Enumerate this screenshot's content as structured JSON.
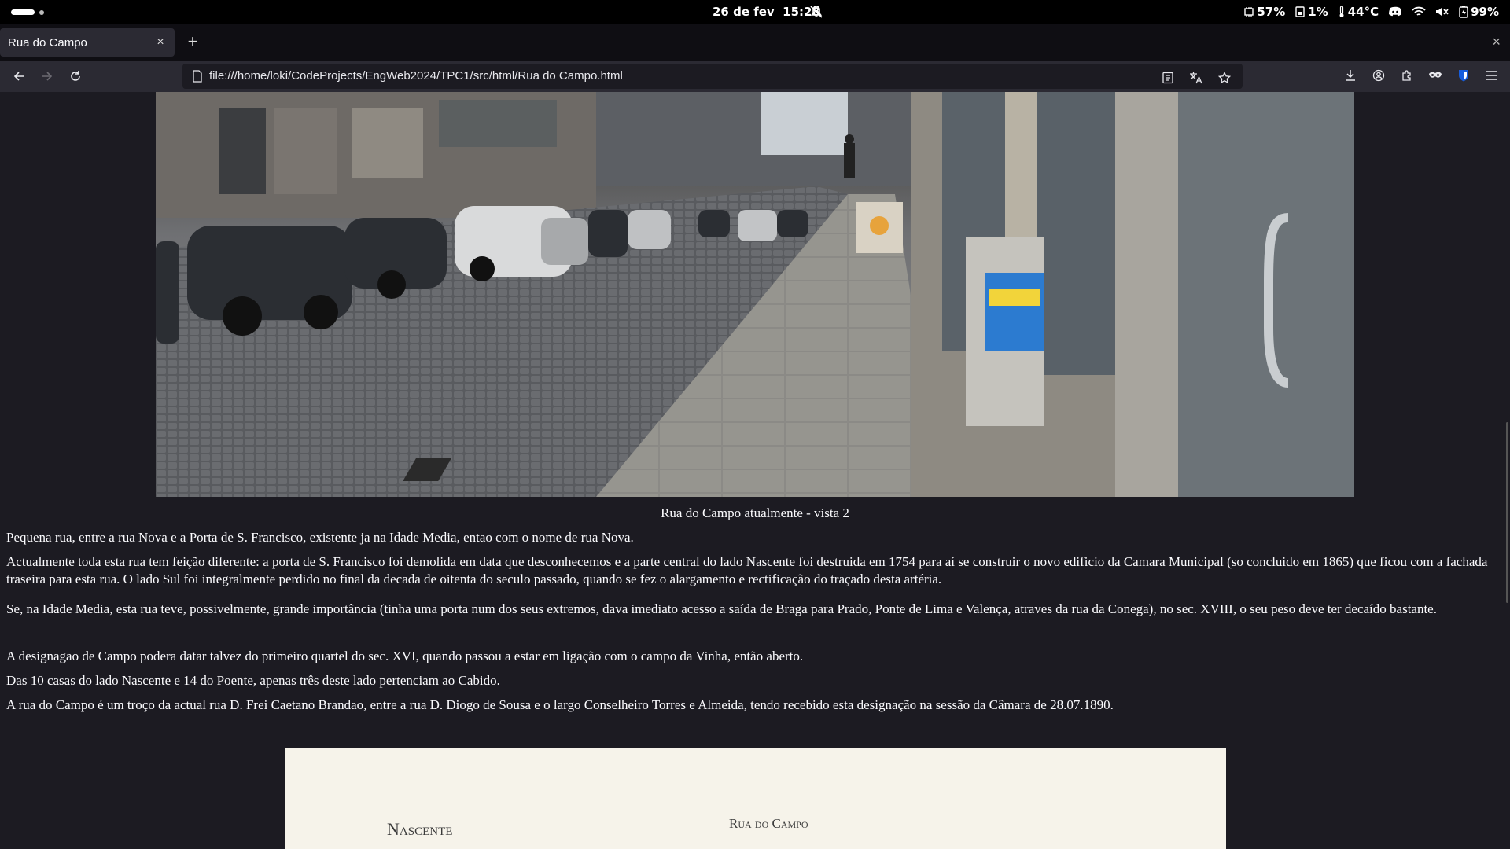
{
  "system_bar": {
    "date": "26 de fev",
    "time": "15:28",
    "cpu": "57%",
    "disk": "1%",
    "temperature": "44°C",
    "battery": "99%"
  },
  "browser": {
    "tab_title": "Rua do Campo",
    "new_tab_icon": "+",
    "close_icon": "×",
    "url": "file:///home/loki/CodeProjects/EngWeb2024/TPC1/src/html/Rua do Campo.html"
  },
  "page": {
    "caption": "Rua do Campo atualmente - vista 2",
    "paragraphs": [
      "Pequena rua, entre a rua Nova e a Porta de S. Francisco, existente ja na Idade Media, entao com o nome de rua Nova.",
      "Actualmente toda esta rua tem feição diferente: a porta de S. Francisco foi demolida em data que desconhecemos e a parte central do lado Nascente foi destruida em 1754 para aí se construir o novo edificio da Camara Municipal (so concluido em 1865) que ficou com a fachada traseira para esta rua. O lado Sul foi integralmente perdido no final da decada de oitenta do seculo passado, quando se fez o alargamento e rectificação do traçado desta artéria.",
      "Se, na Idade Media, esta rua teve, possivelmente, grande importância (tinha uma porta num dos seus extremos, dava imediato acesso a saída de Braga para Prado, Ponte de Lima e Valença, atraves da rua da Conega), no sec. XVIII, o seu peso deve ter decaído bastante.",
      "A designagao de Campo podera datar talvez do primeiro quartel do sec. XVI, quando passou a estar em ligação com o campo da Vinha, então aberto.",
      "Das 10 casas do lado Nascente e 14 do Poente, apenas três deste lado pertenciam ao Cabido.",
      "A rua do Campo é um troço da actual rua D. Frei Caetano Brandao, entre a rua D. Diogo de Sousa e o largo Conselheiro Torres e Almeida, tendo recebido esta designação na sessão da Câmara de 28.07.1890."
    ],
    "plan_labels": {
      "left": "Nascente",
      "top": "Rua do Campo"
    }
  }
}
